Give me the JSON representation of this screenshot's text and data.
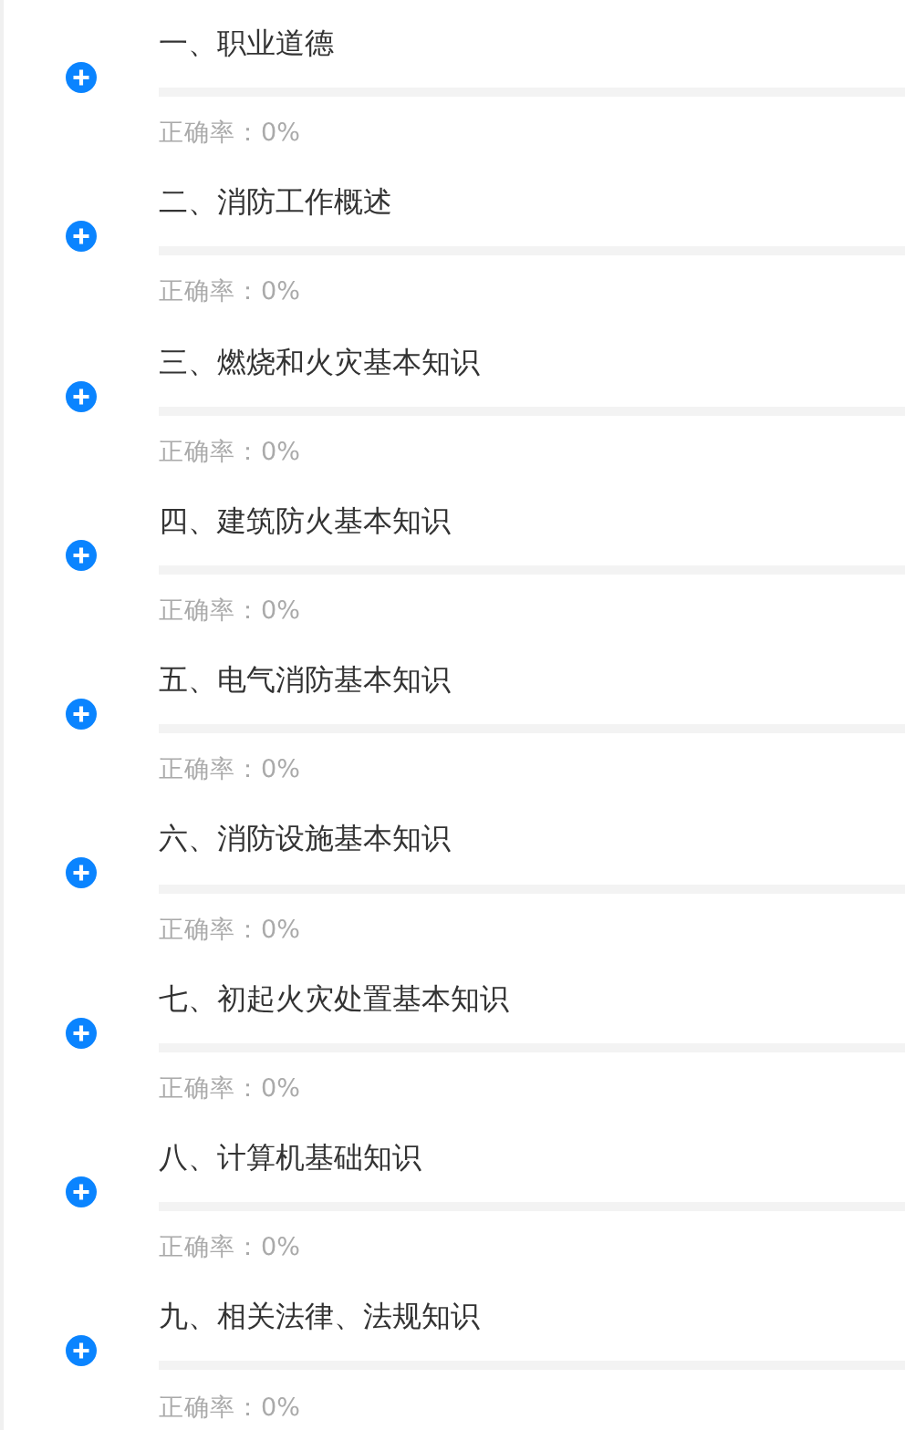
{
  "chapters": [
    {
      "title": "一、职业道德",
      "level": 0,
      "accuracy": "正确率：0%"
    },
    {
      "title": "二、消防工作概述",
      "level": 0,
      "accuracy": "正确率：0%"
    },
    {
      "title": "三、燃烧和火灾基本知识",
      "level": 0,
      "accuracy": "正确率：0%"
    },
    {
      "title": "四、建筑防火基本知识",
      "level": 0,
      "accuracy": "正确率：0%"
    },
    {
      "title": "五、电气消防基本知识",
      "level": 0,
      "accuracy": "正确率：0%"
    },
    {
      "title": "六、消防设施基本知识",
      "level": 0,
      "accuracy": "正确率：0%"
    },
    {
      "title": "七、初起火灾处置基本知识",
      "level": 0,
      "accuracy": "正确率：0%"
    },
    {
      "title": "八、计算机基础知识",
      "level": 0,
      "accuracy": "正确率：0%"
    },
    {
      "title": "九、相关法律、法规知识",
      "level": 0,
      "accuracy": "正确率：0%"
    }
  ]
}
